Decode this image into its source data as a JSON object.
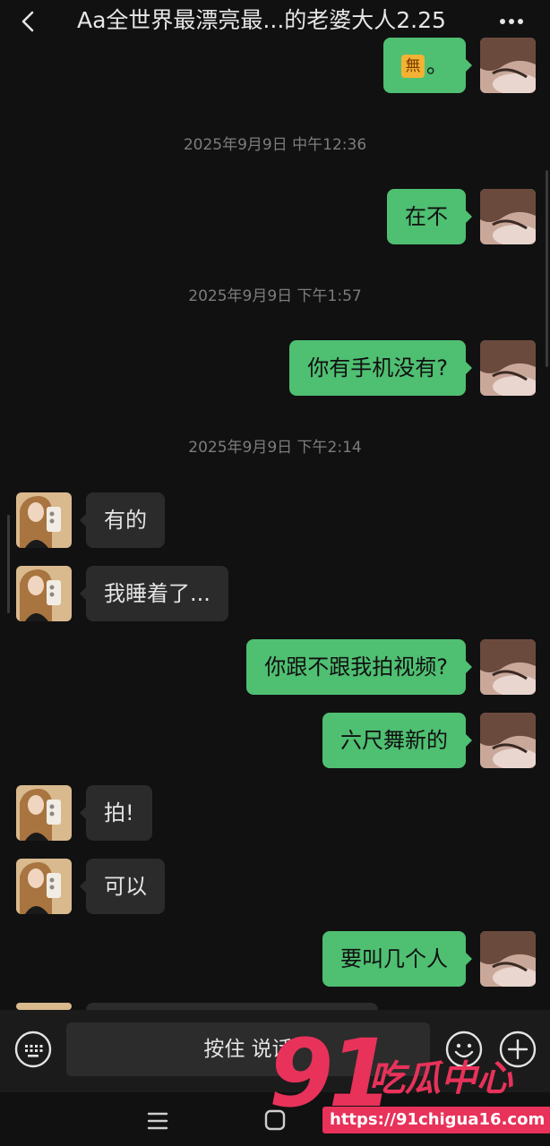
{
  "header": {
    "title": "Aa全世界最漂亮最...的老婆大人2.25",
    "back_icon": "chevron-left-icon",
    "more_icon": "more-dots-icon"
  },
  "messages": [
    {
      "type": "self",
      "emoji": "無",
      "text": "。"
    },
    {
      "type": "timestamp",
      "text": "2025年9月9日 中午12:36"
    },
    {
      "type": "self",
      "text": "在不"
    },
    {
      "type": "timestamp",
      "text": "2025年9月9日 下午1:57"
    },
    {
      "type": "self",
      "text": "你有手机没有?"
    },
    {
      "type": "timestamp",
      "text": "2025年9月9日 下午2:14"
    },
    {
      "type": "other",
      "text": "有的"
    },
    {
      "type": "other",
      "text": "我睡着了..."
    },
    {
      "type": "self",
      "text": "你跟不跟我拍视频?"
    },
    {
      "type": "self",
      "text": "六尺舞新的"
    },
    {
      "type": "other",
      "text": "拍!"
    },
    {
      "type": "other",
      "text": "可以"
    },
    {
      "type": "self",
      "text": "要叫几个人"
    }
  ],
  "input_bar": {
    "voice_label": "按住 说话",
    "keyboard_icon": "keyboard-icon",
    "emoji_icon": "smiley-icon",
    "plus_icon": "plus-icon"
  },
  "nav_bar": {
    "menu_icon": "menu-icon",
    "home_icon": "home-square-icon"
  },
  "watermark": {
    "number": "91",
    "brand": "吃瓜中心",
    "url": "https://91chigua16.com"
  },
  "colors": {
    "self_bubble": "#4fbf72",
    "other_bubble": "#2b2b2b",
    "background": "#111111",
    "watermark": "#e8325a"
  }
}
